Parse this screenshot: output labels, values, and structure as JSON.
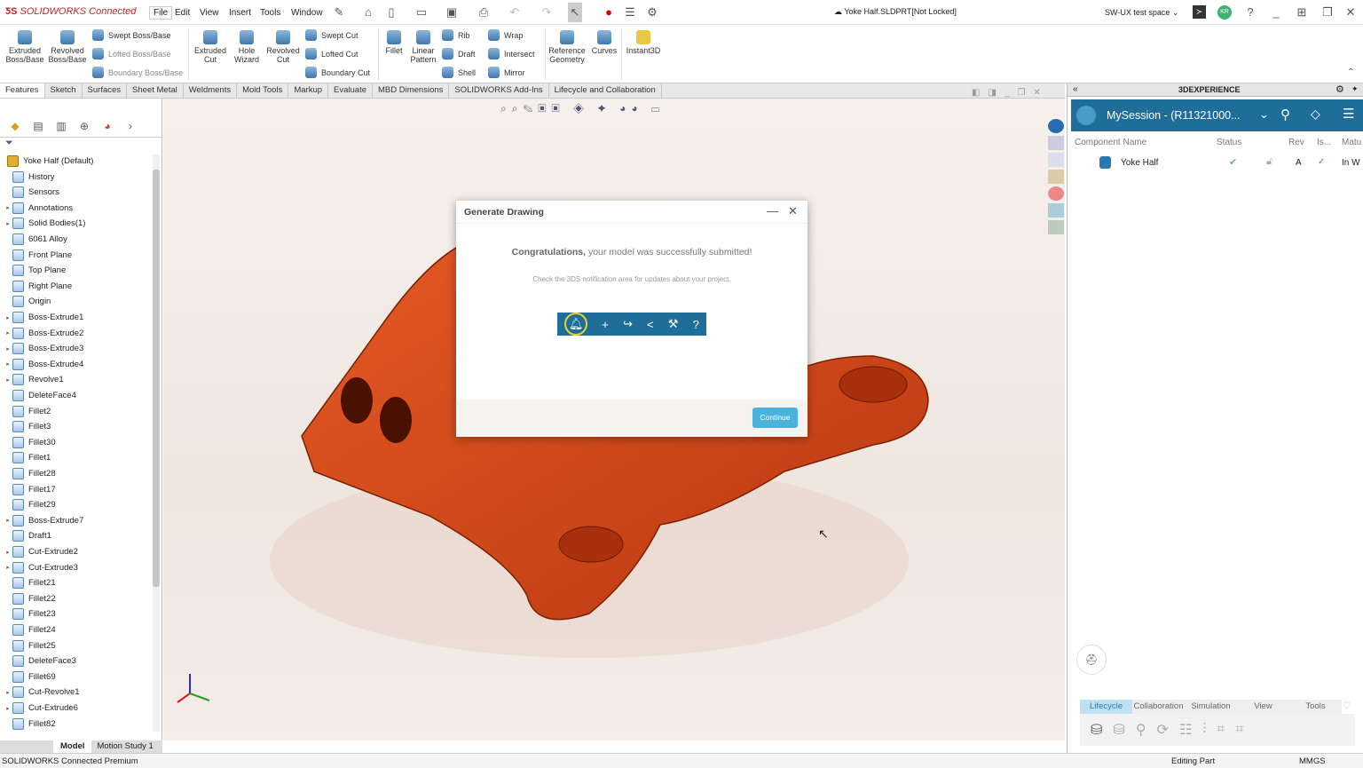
{
  "app": {
    "logo": "SOLIDWORKS Connected",
    "title": "Yoke Half.SLDPRT[Not Locked]",
    "workspace": "SW-UX test space",
    "avatar": "KR"
  },
  "menu": [
    "File",
    "Edit",
    "View",
    "Insert",
    "Tools",
    "Window"
  ],
  "ribbon": {
    "large": [
      {
        "label": "Extruded Boss/Base"
      },
      {
        "label": "Revolved Boss/Base"
      },
      {
        "label": "Extruded Cut"
      },
      {
        "label": "Hole Wizard"
      },
      {
        "label": "Revolved Cut"
      },
      {
        "label": "Fillet"
      },
      {
        "label": "Linear Pattern"
      },
      {
        "label": "Reference Geometry"
      },
      {
        "label": "Curves"
      },
      {
        "label": "Instant3D"
      }
    ],
    "small": [
      "Swept Boss/Base",
      "Lofted Boss/Base",
      "Boundary Boss/Base",
      "Swept Cut",
      "Lofted Cut",
      "Boundary Cut",
      "Rib",
      "Draft",
      "Shell",
      "Wrap",
      "Intersect",
      "Mirror"
    ]
  },
  "tabs": [
    "Features",
    "Sketch",
    "Surfaces",
    "Sheet Metal",
    "Weldments",
    "Mold Tools",
    "Markup",
    "Evaluate",
    "MBD Dimensions",
    "SOLIDWORKS Add-Ins",
    "Lifecycle and Collaboration"
  ],
  "tree": [
    {
      "label": "Yoke Half (Default)",
      "exp": false
    },
    {
      "label": "History"
    },
    {
      "label": "Sensors"
    },
    {
      "label": "Annotations",
      "exp": true
    },
    {
      "label": "Solid Bodies(1)",
      "exp": true
    },
    {
      "label": "6061 Alloy"
    },
    {
      "label": "Front Plane"
    },
    {
      "label": "Top Plane"
    },
    {
      "label": "Right Plane"
    },
    {
      "label": "Origin"
    },
    {
      "label": "Boss-Extrude1",
      "exp": true
    },
    {
      "label": "Boss-Extrude2",
      "exp": true
    },
    {
      "label": "Boss-Extrude3",
      "exp": true
    },
    {
      "label": "Boss-Extrude4",
      "exp": true
    },
    {
      "label": "Revolve1",
      "exp": true
    },
    {
      "label": "DeleteFace4"
    },
    {
      "label": "Fillet2"
    },
    {
      "label": "Fillet3"
    },
    {
      "label": "Fillet30"
    },
    {
      "label": "Fillet1"
    },
    {
      "label": "Fillet28"
    },
    {
      "label": "Fillet17"
    },
    {
      "label": "Fillet29"
    },
    {
      "label": "Boss-Extrude7",
      "exp": true
    },
    {
      "label": "Draft1"
    },
    {
      "label": "Cut-Extrude2",
      "exp": true
    },
    {
      "label": "Cut-Extrude3",
      "exp": true
    },
    {
      "label": "Fillet21"
    },
    {
      "label": "Fillet22"
    },
    {
      "label": "Fillet23"
    },
    {
      "label": "Fillet24"
    },
    {
      "label": "Fillet25"
    },
    {
      "label": "DeleteFace3"
    },
    {
      "label": "Fillet69"
    },
    {
      "label": "Cut-Revolve1",
      "exp": true
    },
    {
      "label": "Cut-Extrude6",
      "exp": true
    },
    {
      "label": "Fillet82"
    }
  ],
  "bottom_tabs": [
    "Model",
    "Motion Study 1"
  ],
  "dialog": {
    "title": "Generate Drawing",
    "congrats_bold": "Congratulations,",
    "congrats_rest": " your model was successfully submitted!",
    "hint": "Check the 3DS notification area for updates about your project.",
    "continue": "Continue",
    "toolbar_icons": [
      "bell-icon",
      "plus-icon",
      "share-icon",
      "network-icon",
      "collaborate-icon",
      "help-icon"
    ]
  },
  "rpanel": {
    "header": "3DEXPERIENCE",
    "session": "MySession - (R11321000...",
    "columns": [
      "Component Name",
      "Status",
      "Rev",
      "Is...",
      "Matu"
    ],
    "row": {
      "name": "Yoke Half",
      "rev": "A",
      "maturity": "In W"
    },
    "tabs": [
      "Lifecycle",
      "Collaboration",
      "Simulation",
      "View",
      "Tools"
    ]
  },
  "status": {
    "left": "SOLIDWORKS Connected Premium",
    "mode": "Editing Part",
    "units": "MMGS"
  },
  "colors": {
    "accent": "#1f6e9a",
    "model": "#d4461a",
    "continue": "#4ab3dc"
  }
}
